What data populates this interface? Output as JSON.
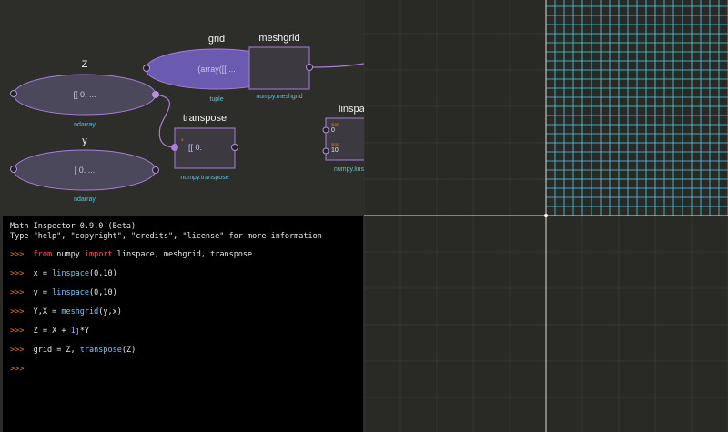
{
  "graph": {
    "nodes": [
      {
        "title": "Z",
        "value": "[[ 0.        ...",
        "type": "ndarray"
      },
      {
        "title": "y",
        "value": "[ 0.        ...",
        "type": "ndarray"
      },
      {
        "title": "grid",
        "value": "(array([[ ...",
        "type": "tuple"
      },
      {
        "title": "transpose",
        "value": "[[ 0.",
        "type": "numpy.transpose"
      },
      {
        "title": "meshgrid",
        "type": "numpy.meshgrid"
      },
      {
        "title": "linspa",
        "type": "numpy.lins",
        "param_start_label": "start",
        "param_start_value": "0",
        "param_stop_label": "stop",
        "param_stop_value": "10"
      }
    ],
    "colors": {
      "edge": "#a97ed9",
      "node_fill": "#4f4a6e",
      "grid_node_fill": "#6a5bb0",
      "port": "#b48ee0"
    }
  },
  "console": {
    "banner1": "Math Inspector 0.9.0 (Beta)",
    "banner2": "Type \"help\", \"copyright\", \"credits\", \"license\" for more information",
    "prompt": ">>>",
    "lines": [
      {
        "kw": "from",
        "a": " numpy ",
        "kw2": "import",
        "b": " linspace, meshgrid, transpose"
      },
      {
        "a": "x = ",
        "fn": "linspace",
        "b": "(0,10)"
      },
      {
        "a": "y = ",
        "fn": "linspace",
        "b": "(0,10)"
      },
      {
        "a": "Y,X = ",
        "fn": "meshgrid",
        "b": "(y,x)"
      },
      {
        "a": "Z = X + ",
        "num": "1j",
        "b": "*Y"
      },
      {
        "a": "grid = Z, ",
        "fn": "transpose",
        "b": "(Z)"
      }
    ]
  },
  "plot": {
    "grid_cells": 20,
    "colors": {
      "background": "#292926",
      "minor_grid": "#38382f",
      "axis": "#dcdcdc",
      "mesh": "#4fd0e6"
    }
  }
}
